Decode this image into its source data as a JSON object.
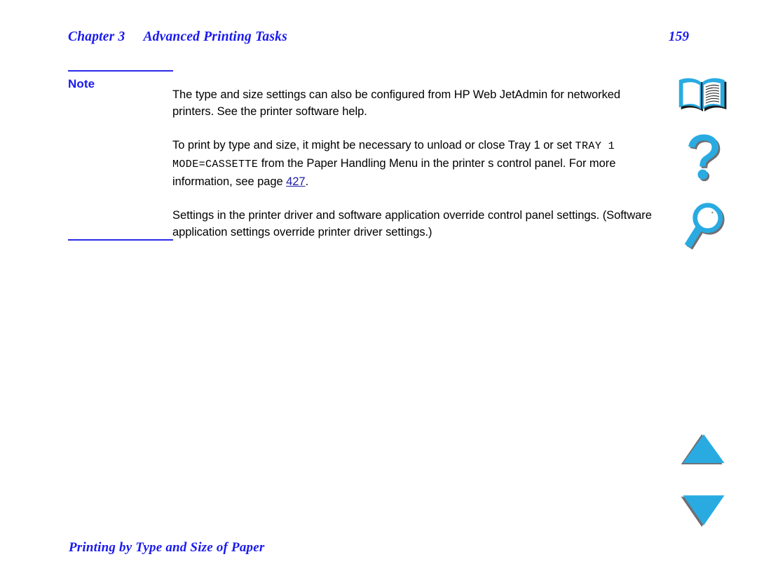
{
  "document": {
    "header": {
      "chapter_label": "Chapter 3",
      "chapter_title": "Advanced Printing Tasks",
      "page_number": "159"
    },
    "note": {
      "label": "Note",
      "paragraphs": [
        {
          "id": "note-para-1",
          "segments": [
            {
              "type": "text",
              "value": "The type and size settings can also be configured from HP Web JetAdmin for networked printers. See the printer software help."
            }
          ],
          "plain": "The type and size settings can also be configured from HP Web JetAdmin for networked printers. See the printer software help."
        },
        {
          "id": "note-para-2",
          "segments": [
            {
              "type": "text",
              "value": "To print by type and size, it might be necessary to unload or close Tray 1 or set "
            },
            {
              "type": "mono",
              "value": "TRAY 1 MODE=CASSETTE"
            },
            {
              "type": "text",
              "value": " from the Paper Handling Menu in the printer s control panel. For more information, see page "
            },
            {
              "type": "xref",
              "value": "427"
            },
            {
              "type": "text",
              "value": "."
            }
          ],
          "plain": "To print by type and size, it might be necessary to unload or close Tray 1 or set TRAY 1 MODE=CASSETTE from the Paper Handling Menu in the printer s control panel. For more information, see page 427."
        },
        {
          "id": "note-para-3",
          "segments": [
            {
              "type": "text",
              "value": "Settings in the printer driver and software application override control panel settings. (Software application settings override printer driver settings.)"
            }
          ],
          "plain": "Settings in the printer driver and software application override control panel settings. (Software application settings override printer driver settings.)"
        }
      ],
      "body_p1_text": "The type and size settings can also be configured from HP Web JetAdmin for networked printers. See the printer software help.",
      "body_p2_lead": "To print by type and size, it might be necessary to unload or close Tray 1 or set ",
      "body_p2_code": "TRAY 1 MODE=CASSETTE",
      "body_p2_mid": " from the Paper Handling Menu in the printer s control panel. For more information, see page ",
      "body_p2_xref": "427",
      "body_p2_tail": ".",
      "body_p3_text": "Settings in the printer driver and software application override control panel settings. (Software application settings override printer driver settings.)"
    },
    "footer": {
      "section_title": "Printing by Type and Size of Paper"
    }
  },
  "nav_icons": [
    {
      "name": "book-icon",
      "title": "Table of Contents"
    },
    {
      "name": "question-mark-icon",
      "title": "Help"
    },
    {
      "name": "magnifier-icon",
      "title": "Search"
    },
    {
      "name": "triangle-up-icon",
      "title": "Previous Page"
    },
    {
      "name": "triangle-down-icon",
      "title": "Next Page"
    }
  ],
  "colors": {
    "heading_blue": "#1a1aee",
    "rule_blue": "#2a2aea",
    "link_blue": "#1d1da8",
    "icon_cyan": "#29abe2",
    "icon_shadow": "#6f6f73",
    "body_black": "#000000",
    "page_background": "#ffffff"
  }
}
